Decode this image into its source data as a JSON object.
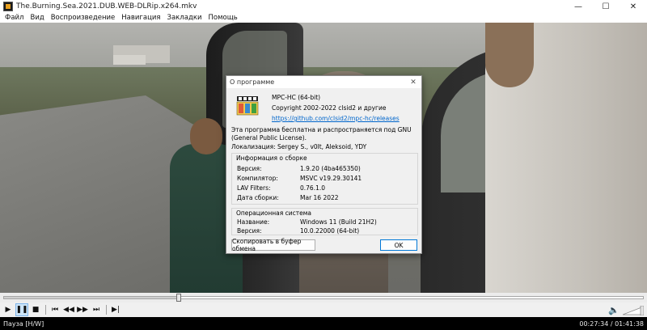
{
  "window": {
    "title": "The.Burning.Sea.2021.DUB.WEB-DLRip.x264.mkv",
    "minimize_glyph": "—",
    "maximize_glyph": "☐",
    "close_glyph": "✕"
  },
  "menu": {
    "items": [
      "Файл",
      "Вид",
      "Воспроизведение",
      "Навигация",
      "Закладки",
      "Помощь"
    ]
  },
  "dialog": {
    "title": "О программе",
    "close_glyph": "✕",
    "product": "MPC-HC (64-bit)",
    "copyright": "Copyright 2002-2022 clsid2 и другие",
    "link": "https://github.com/clsid2/mpc-hc/releases",
    "license": "Эта программа бесплатна и распространяется под GNU (General Public License).",
    "localization": "Локализация: Sergey S., v0lt, Aleksoid, YDY",
    "build_group": {
      "title": "Информация о сборке",
      "rows": [
        {
          "label": "Версия:",
          "value": "1.9.20 (4ba465350)"
        },
        {
          "label": "Компилятор:",
          "value": "MSVC v19.29.30141"
        },
        {
          "label": "LAV Filters:",
          "value": "0.76.1.0"
        },
        {
          "label": "Дата сборки:",
          "value": "Mar 16 2022"
        }
      ]
    },
    "os_group": {
      "title": "Операционная система",
      "rows": [
        {
          "label": "Название:",
          "value": "Windows 11 (Build 21H2)"
        },
        {
          "label": "Версия:",
          "value": "10.0.22000 (64-bit)"
        }
      ]
    },
    "copy_button": "Скопировать в буфер обмена",
    "ok_button": "OK"
  },
  "player": {
    "seek_progress": 0.275,
    "buttons": {
      "play": "▶",
      "pause": "❚❚",
      "stop": "■",
      "prev": "⏮",
      "rewind": "◀◀",
      "forward": "▶▶",
      "next": "⏭",
      "frame_step": "▶|"
    },
    "volume_glyph": "🔈",
    "status": "Пауза [H/W]",
    "time": "00:27:34 / 01:41:38"
  },
  "colors": {
    "link": "#0066cc",
    "ok_border": "#0078d7",
    "active_button": "#cce4f7"
  }
}
